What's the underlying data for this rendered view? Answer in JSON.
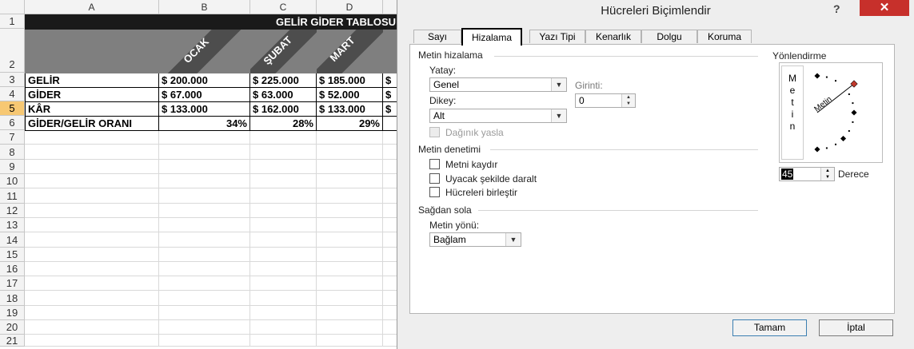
{
  "sheet": {
    "columns": [
      "A",
      "B",
      "C",
      "D"
    ],
    "rows": [
      "1",
      "2",
      "3",
      "4",
      "5",
      "6",
      "7",
      "8",
      "9",
      "10",
      "11",
      "12",
      "13",
      "14",
      "15",
      "16",
      "17",
      "18",
      "19",
      "20",
      "21"
    ],
    "title": "GELİR GİDER TABLOSU",
    "months": [
      "OCAK",
      "ŞUBAT",
      "MART"
    ],
    "data": [
      {
        "label": "GELİR",
        "b": "$ 200.000",
        "c": "$ 225.000",
        "d": "$ 185.000",
        "e": "$"
      },
      {
        "label": "GİDER",
        "b": "$ 67.000",
        "c": "$ 63.000",
        "d": "$ 52.000",
        "e": "$"
      },
      {
        "label": "KÂR",
        "b": "$ 133.000",
        "c": "$ 162.000",
        "d": "$ 133.000",
        "e": "$"
      },
      {
        "label": "GİDER/GELİR ORANI",
        "b": "34%",
        "c": "28%",
        "d": "29%",
        "e": ""
      }
    ],
    "selected_row": "5"
  },
  "dialog": {
    "title": "Hücreleri Biçimlendir",
    "help": "?",
    "close": "✕",
    "tabs": [
      "Sayı",
      "Hizalama",
      "Yazı Tipi",
      "Kenarlık",
      "Dolgu",
      "Koruma"
    ],
    "active_tab": "Hizalama",
    "text_alignment_group": "Metin hizalama",
    "horizontal_label": "Yatay:",
    "horizontal_value": "Genel",
    "indent_label": "Girinti:",
    "indent_value": "0",
    "vertical_label": "Dikey:",
    "vertical_value": "Alt",
    "distributed_label": "Dağınık yasla",
    "text_control_group": "Metin denetimi",
    "wrap_text": "Metni kaydır",
    "shrink_to_fit": "Uyacak şekilde daralt",
    "merge_cells": "Hücreleri birleştir",
    "rtl_group": "Sağdan sola",
    "text_direction_label": "Metin yönü:",
    "text_direction_value": "Bağlam",
    "orientation_group": "Yönlendirme",
    "vertical_text": "Metin",
    "dial_text": "Metin",
    "degree_value": "45",
    "degree_label": "Derece",
    "ok": "Tamam",
    "cancel": "İptal"
  },
  "colors": {
    "title_fill": "#1a1a1a",
    "header_fill": "#7f7f7f",
    "diagonal_band": "#4d4d4d",
    "selected_row_header": "#f7c873",
    "close_button": "#c7302b",
    "dial_marker": "#c0392b"
  }
}
